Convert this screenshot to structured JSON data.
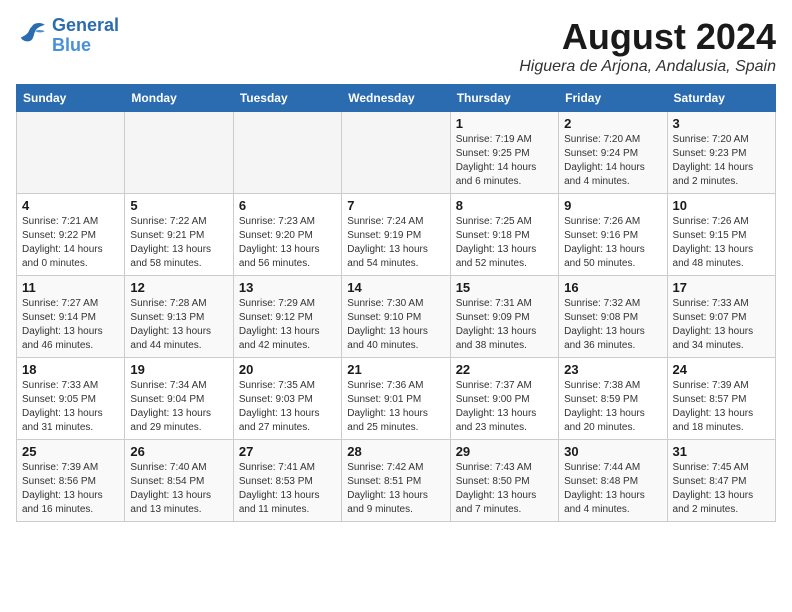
{
  "header": {
    "logo_line1": "General",
    "logo_line2": "Blue",
    "month_title": "August 2024",
    "location": "Higuera de Arjona, Andalusia, Spain"
  },
  "weekdays": [
    "Sunday",
    "Monday",
    "Tuesday",
    "Wednesday",
    "Thursday",
    "Friday",
    "Saturday"
  ],
  "weeks": [
    [
      {
        "day": "",
        "content": ""
      },
      {
        "day": "",
        "content": ""
      },
      {
        "day": "",
        "content": ""
      },
      {
        "day": "",
        "content": ""
      },
      {
        "day": "1",
        "content": "Sunrise: 7:19 AM\nSunset: 9:25 PM\nDaylight: 14 hours\nand 6 minutes."
      },
      {
        "day": "2",
        "content": "Sunrise: 7:20 AM\nSunset: 9:24 PM\nDaylight: 14 hours\nand 4 minutes."
      },
      {
        "day": "3",
        "content": "Sunrise: 7:20 AM\nSunset: 9:23 PM\nDaylight: 14 hours\nand 2 minutes."
      }
    ],
    [
      {
        "day": "4",
        "content": "Sunrise: 7:21 AM\nSunset: 9:22 PM\nDaylight: 14 hours\nand 0 minutes."
      },
      {
        "day": "5",
        "content": "Sunrise: 7:22 AM\nSunset: 9:21 PM\nDaylight: 13 hours\nand 58 minutes."
      },
      {
        "day": "6",
        "content": "Sunrise: 7:23 AM\nSunset: 9:20 PM\nDaylight: 13 hours\nand 56 minutes."
      },
      {
        "day": "7",
        "content": "Sunrise: 7:24 AM\nSunset: 9:19 PM\nDaylight: 13 hours\nand 54 minutes."
      },
      {
        "day": "8",
        "content": "Sunrise: 7:25 AM\nSunset: 9:18 PM\nDaylight: 13 hours\nand 52 minutes."
      },
      {
        "day": "9",
        "content": "Sunrise: 7:26 AM\nSunset: 9:16 PM\nDaylight: 13 hours\nand 50 minutes."
      },
      {
        "day": "10",
        "content": "Sunrise: 7:26 AM\nSunset: 9:15 PM\nDaylight: 13 hours\nand 48 minutes."
      }
    ],
    [
      {
        "day": "11",
        "content": "Sunrise: 7:27 AM\nSunset: 9:14 PM\nDaylight: 13 hours\nand 46 minutes."
      },
      {
        "day": "12",
        "content": "Sunrise: 7:28 AM\nSunset: 9:13 PM\nDaylight: 13 hours\nand 44 minutes."
      },
      {
        "day": "13",
        "content": "Sunrise: 7:29 AM\nSunset: 9:12 PM\nDaylight: 13 hours\nand 42 minutes."
      },
      {
        "day": "14",
        "content": "Sunrise: 7:30 AM\nSunset: 9:10 PM\nDaylight: 13 hours\nand 40 minutes."
      },
      {
        "day": "15",
        "content": "Sunrise: 7:31 AM\nSunset: 9:09 PM\nDaylight: 13 hours\nand 38 minutes."
      },
      {
        "day": "16",
        "content": "Sunrise: 7:32 AM\nSunset: 9:08 PM\nDaylight: 13 hours\nand 36 minutes."
      },
      {
        "day": "17",
        "content": "Sunrise: 7:33 AM\nSunset: 9:07 PM\nDaylight: 13 hours\nand 34 minutes."
      }
    ],
    [
      {
        "day": "18",
        "content": "Sunrise: 7:33 AM\nSunset: 9:05 PM\nDaylight: 13 hours\nand 31 minutes."
      },
      {
        "day": "19",
        "content": "Sunrise: 7:34 AM\nSunset: 9:04 PM\nDaylight: 13 hours\nand 29 minutes."
      },
      {
        "day": "20",
        "content": "Sunrise: 7:35 AM\nSunset: 9:03 PM\nDaylight: 13 hours\nand 27 minutes."
      },
      {
        "day": "21",
        "content": "Sunrise: 7:36 AM\nSunset: 9:01 PM\nDaylight: 13 hours\nand 25 minutes."
      },
      {
        "day": "22",
        "content": "Sunrise: 7:37 AM\nSunset: 9:00 PM\nDaylight: 13 hours\nand 23 minutes."
      },
      {
        "day": "23",
        "content": "Sunrise: 7:38 AM\nSunset: 8:59 PM\nDaylight: 13 hours\nand 20 minutes."
      },
      {
        "day": "24",
        "content": "Sunrise: 7:39 AM\nSunset: 8:57 PM\nDaylight: 13 hours\nand 18 minutes."
      }
    ],
    [
      {
        "day": "25",
        "content": "Sunrise: 7:39 AM\nSunset: 8:56 PM\nDaylight: 13 hours\nand 16 minutes."
      },
      {
        "day": "26",
        "content": "Sunrise: 7:40 AM\nSunset: 8:54 PM\nDaylight: 13 hours\nand 13 minutes."
      },
      {
        "day": "27",
        "content": "Sunrise: 7:41 AM\nSunset: 8:53 PM\nDaylight: 13 hours\nand 11 minutes."
      },
      {
        "day": "28",
        "content": "Sunrise: 7:42 AM\nSunset: 8:51 PM\nDaylight: 13 hours\nand 9 minutes."
      },
      {
        "day": "29",
        "content": "Sunrise: 7:43 AM\nSunset: 8:50 PM\nDaylight: 13 hours\nand 7 minutes."
      },
      {
        "day": "30",
        "content": "Sunrise: 7:44 AM\nSunset: 8:48 PM\nDaylight: 13 hours\nand 4 minutes."
      },
      {
        "day": "31",
        "content": "Sunrise: 7:45 AM\nSunset: 8:47 PM\nDaylight: 13 hours\nand 2 minutes."
      }
    ]
  ]
}
